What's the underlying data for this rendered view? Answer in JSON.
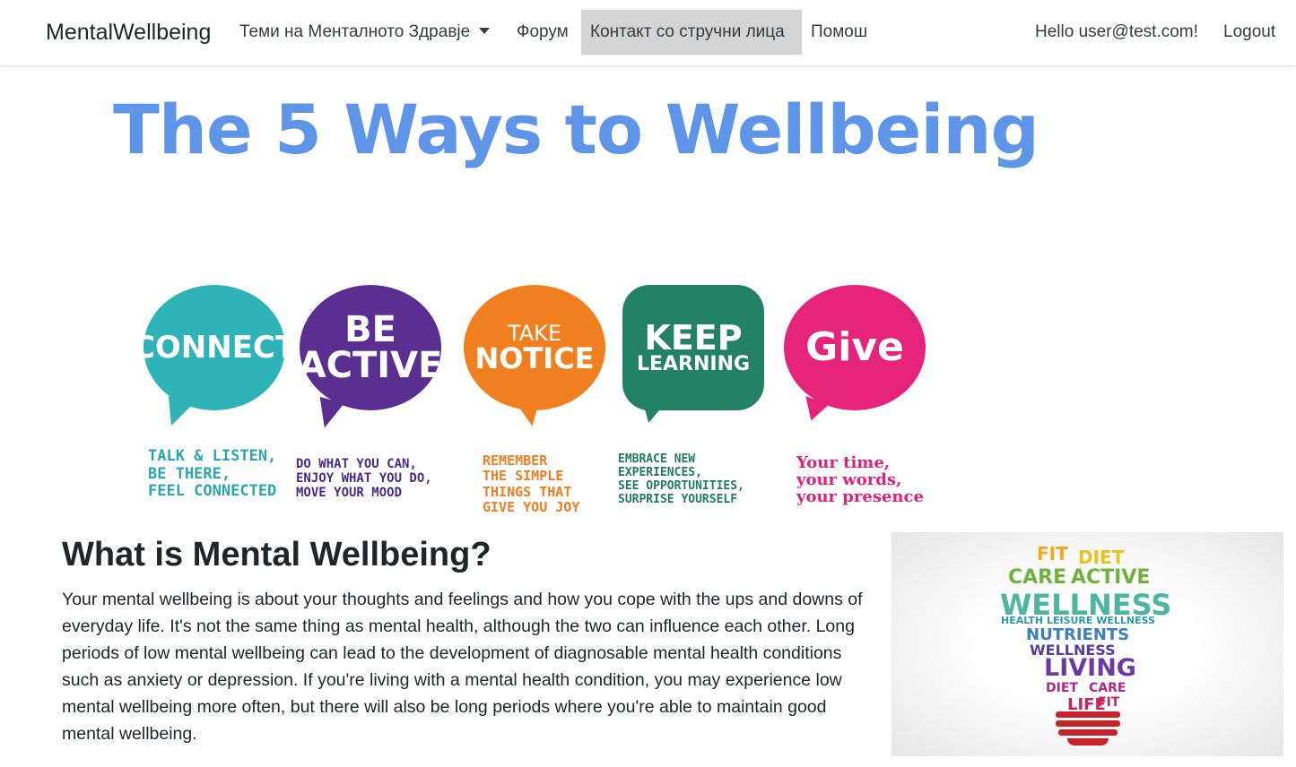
{
  "navbar": {
    "brand": "MentalWellbeing",
    "items": [
      {
        "label": "Теми на Менталното Здравје"
      },
      {
        "label": "Форум"
      },
      {
        "label": "Контакт со стручни лица"
      },
      {
        "label": "Помош"
      }
    ],
    "greeting": "Hello user@test.com!",
    "logout": "Logout"
  },
  "hero": {
    "title": "The 5 Ways to Wellbeing",
    "ways": [
      {
        "line1": "CONNECT",
        "line2": "",
        "description": "Talk & listen,\nbe there,\nfeel connected",
        "color": "#2eb3b8",
        "text_color": "#2aa6ad"
      },
      {
        "line1": "BE",
        "line2": "ACTIVE",
        "description": "Do what you can,\nenjoy what you do,\nmove your mood",
        "color": "#5b2f91",
        "text_color": "#4a2a85"
      },
      {
        "line1": "TAKE",
        "line2": "NOTICE",
        "description": "Remember\nthe simple\nthings that\ngive you joy",
        "color": "#f0801f",
        "text_color": "#ef7d22"
      },
      {
        "line1": "KEEP",
        "line2": "LEARNING",
        "description": "Embrace new\nexperiences,\nsee opportunities,\nsurprise yourself",
        "color": "#238266",
        "text_color": "#227a60"
      },
      {
        "line1": "Give",
        "line2": "",
        "description": "Your time,\nyour words,\nyour presence",
        "color": "#e6237a",
        "text_color": "#e0217a"
      }
    ]
  },
  "article": {
    "title": "What is Mental Wellbeing?",
    "body": "Your mental wellbeing is about your thoughts and feelings and how you cope with the ups and downs of everyday life. It's not the same thing as mental health, although the two can influence each other. Long periods of low mental wellbeing can lead to the development of diagnosable mental health conditions such as anxiety or depression. If you're living with a mental health condition, you may experience low mental wellbeing more often, but there will also be long periods where you're able to maintain good mental wellbeing."
  },
  "wellness_image": {
    "words": [
      "FIT",
      "DIET",
      "CARE",
      "ACTIVE",
      "WELLNESS",
      "HEALTH LEISURE WELLNESS",
      "NUTRIENTS",
      "WELLNESS",
      "LIVING",
      "DIET",
      "CARE",
      "LIFE",
      "FIT"
    ]
  }
}
